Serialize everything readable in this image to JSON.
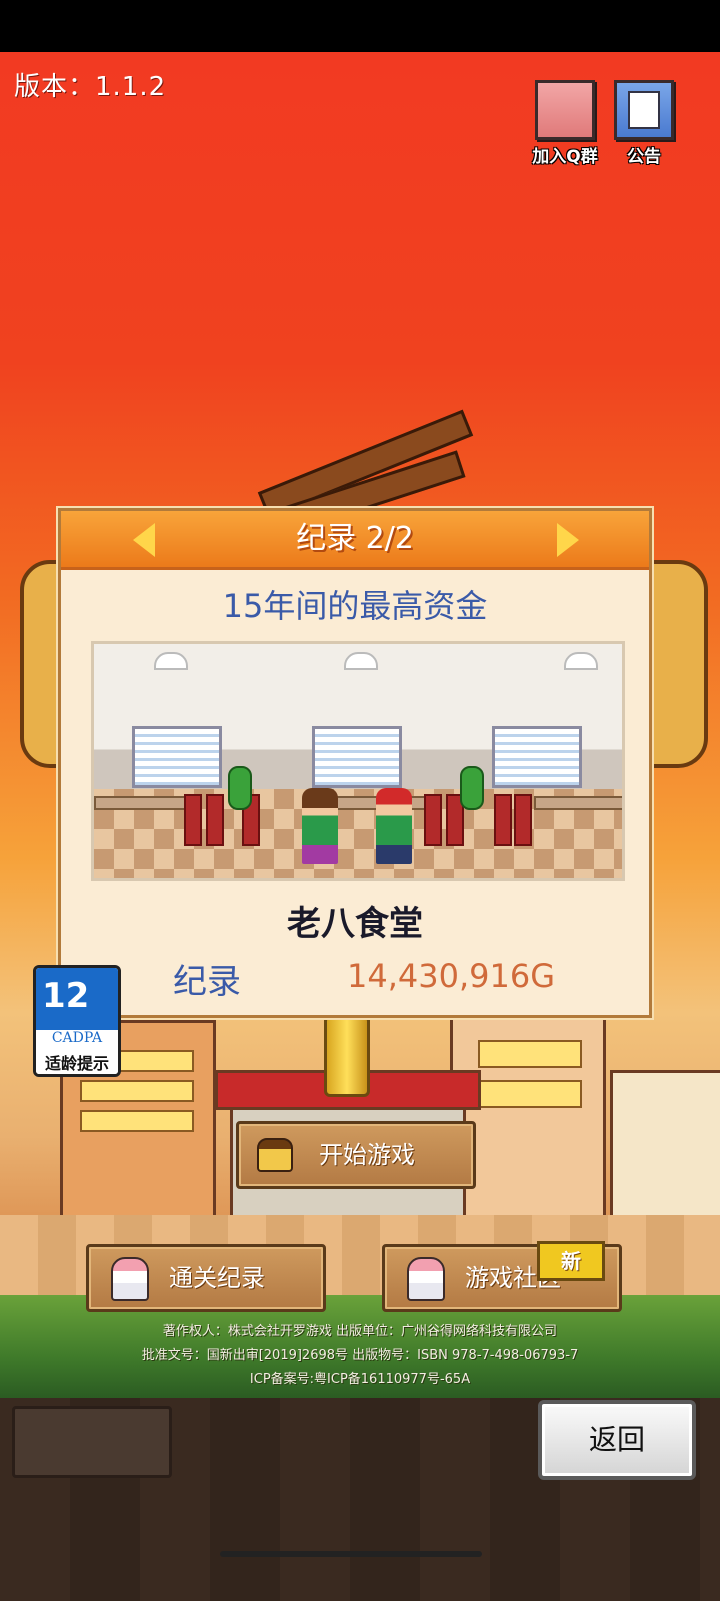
{
  "header": {
    "version_text": "版本：1.1.2"
  },
  "top_buttons": {
    "join_qq_label": "加入Q群",
    "notice_label": "公告"
  },
  "record_panel": {
    "title": "纪录 2/2",
    "subtitle": "15年间的最高资金",
    "restaurant_name": "老八食堂",
    "record_label": "纪录",
    "record_value": "14,430,916G"
  },
  "age_rating": {
    "number": "12",
    "org": "CADPA",
    "caption": "适龄提示"
  },
  "buttons": {
    "start_game": "开始游戏",
    "clear_records": "通关纪录",
    "community": "游戏社区",
    "new_badge": "新",
    "back": "返回"
  },
  "copyright": {
    "line1": "著作权人：株式会社开罗游戏  出版单位：广州谷得网络科技有限公司",
    "line2": "批准文号：国新出审[2019]2698号 出版物号：ISBN 978-7-498-06793-7",
    "line3": "ICP备案号:粤ICP备16110977号-65A"
  },
  "colors": {
    "sky": "#f23a22",
    "panel_bg": "#fbecd4",
    "panel_header": "#ec7a1a",
    "subtitle_blue": "#3a5aa8",
    "value_orange": "#d06a3a",
    "cadpa_blue": "#1a6ac8"
  }
}
